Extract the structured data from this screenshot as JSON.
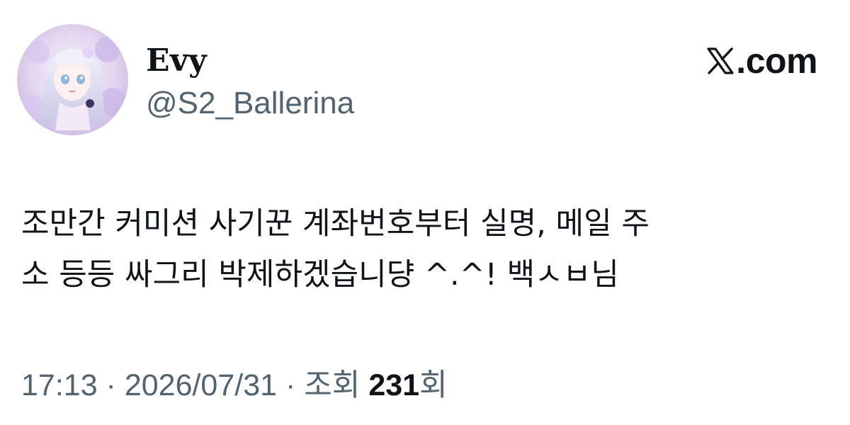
{
  "author": {
    "display_name": "Evy",
    "handle": "@S2_Ballerina",
    "avatar_icon": "anime-girl-avatar"
  },
  "brand": {
    "icon": "x-logo-icon",
    "text": ".com"
  },
  "tweet": {
    "lines": [
      "조만간 커미션 사기꾼 계좌번호부터 실명, 메일 주",
      "소 등등 싸그리 박제하겠습니댱 ^.^! 백ㅅㅂ님"
    ]
  },
  "meta": {
    "time": "17:13",
    "separator1": " · ",
    "date": "2026/07/31",
    "separator2": " · ",
    "views_label": "조회 ",
    "views_count": "231",
    "views_suffix": "회"
  },
  "colors": {
    "text_primary": "#0f1419",
    "text_secondary": "#536471",
    "background": "#ffffff"
  }
}
